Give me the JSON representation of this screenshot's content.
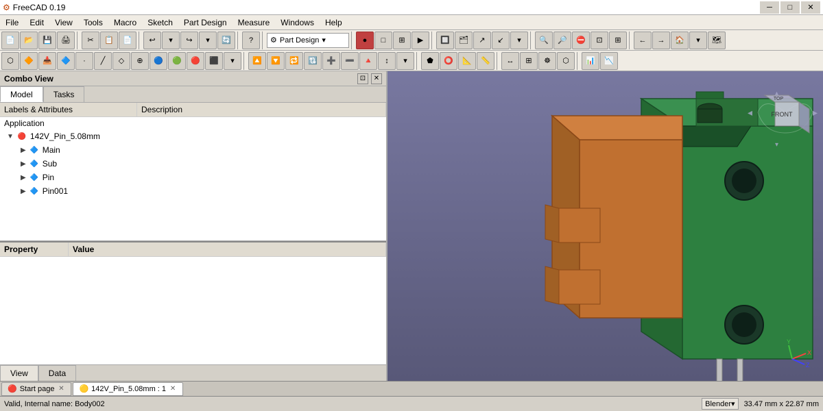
{
  "titlebar": {
    "title": "FreeCAD 0.19",
    "icon": "⚙",
    "controls": {
      "minimize": "─",
      "maximize": "□",
      "close": "✕"
    }
  },
  "menubar": {
    "items": [
      "File",
      "Edit",
      "View",
      "Tools",
      "Macro",
      "Sketch",
      "Part Design",
      "Measure",
      "Windows",
      "Help"
    ]
  },
  "toolbar1": {
    "workbench_label": "Part Design",
    "buttons": [
      "📄",
      "📂",
      "💾",
      "✂",
      "📋",
      "↩",
      "↪",
      "🔄",
      "?",
      "▶"
    ]
  },
  "combo_view": {
    "title": "Combo View",
    "tabs": [
      "Model",
      "Tasks"
    ],
    "active_tab": "Model",
    "headers": {
      "labels": "Labels & Attributes",
      "description": "Description"
    },
    "application_label": "Application",
    "tree_items": [
      {
        "id": "root",
        "label": "142V_Pin_5.08mm",
        "indent": 0,
        "expanded": true,
        "icon": "doc"
      },
      {
        "id": "main",
        "label": "Main",
        "indent": 1,
        "icon": "body"
      },
      {
        "id": "sub",
        "label": "Sub",
        "indent": 1,
        "icon": "body"
      },
      {
        "id": "pin",
        "label": "Pin",
        "indent": 1,
        "icon": "body"
      },
      {
        "id": "pin001",
        "label": "Pin001",
        "indent": 1,
        "icon": "body"
      }
    ]
  },
  "property_panel": {
    "columns": [
      "Property",
      "Value"
    ]
  },
  "bottom_tabs": [
    "View",
    "Data"
  ],
  "docbar": {
    "tabs": [
      {
        "label": "Start page",
        "active": false,
        "closable": true
      },
      {
        "label": "142V_Pin_5.08mm : 1",
        "active": true,
        "closable": true
      }
    ]
  },
  "statusbar": {
    "message": "Valid, Internal name: Body002",
    "blender": "Blender▾",
    "dimensions": "33.47 mm x 22.87 mm"
  },
  "icons": {
    "expand_arrow": "▶",
    "collapse_arrow": "▼",
    "doc_icon": "🔴",
    "body_icon": "🔷",
    "restore": "⊡",
    "pin": "📌"
  },
  "viewport": {
    "bg_color": "#6a6898",
    "object_color_green": "#2d7a3a",
    "object_color_orange": "#c86020"
  }
}
